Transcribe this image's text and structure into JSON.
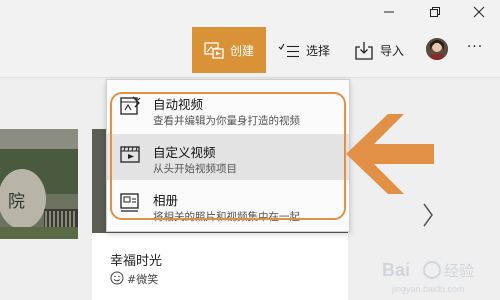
{
  "toolbar": {
    "create_label": "创建",
    "select_label": "选择",
    "import_label": "导入",
    "more_label": "···"
  },
  "menu": {
    "items": [
      {
        "title": "自动视频",
        "desc": "查看并编辑为你量身打造的视频",
        "icon": "auto-video-icon"
      },
      {
        "title": "自定义视频",
        "desc": "从头开始视频项目",
        "icon": "custom-video-icon"
      },
      {
        "title": "相册",
        "desc": "将相关的照片和视频集中在一起",
        "icon": "album-icon"
      }
    ]
  },
  "card": {
    "title": "幸福时光",
    "tag": "#微笑"
  },
  "left_card": {
    "sign_text": "院"
  },
  "watermark": {
    "text": "Bai 经验",
    "subtext": "jingyan.baidu.com"
  },
  "colors": {
    "accent": "#d99235",
    "annotation": "#e39047",
    "menu_hover": "#e3e3e3"
  }
}
